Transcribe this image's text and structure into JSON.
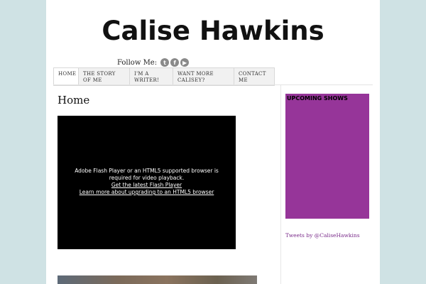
{
  "header": {
    "site_title": "Calise Hawkins",
    "follow_label": "Follow Me:",
    "social_icons": [
      "twitter-icon",
      "facebook-icon",
      "youtube-icon"
    ]
  },
  "nav": {
    "items": [
      {
        "label": "Home",
        "active": true
      },
      {
        "label": "The Story of Me",
        "active": false
      },
      {
        "label": "I'm a Writer!",
        "active": false
      },
      {
        "label": "Want More Calisey?",
        "active": false
      },
      {
        "label": "Contact Me",
        "active": false
      }
    ]
  },
  "main": {
    "heading": "Home",
    "video_message": "Adobe Flash Player or an HTML5 supported browser is required for video playback.",
    "video_link_flash": "Get the latest Flash Player",
    "video_link_html5": "Learn more about upgrading to an HTML5 browser"
  },
  "sidebar": {
    "widget_title": "UPCOMING SHOWS",
    "widget_color": "#963599",
    "tweets_link": "Tweets by @CaliseHawkins"
  }
}
